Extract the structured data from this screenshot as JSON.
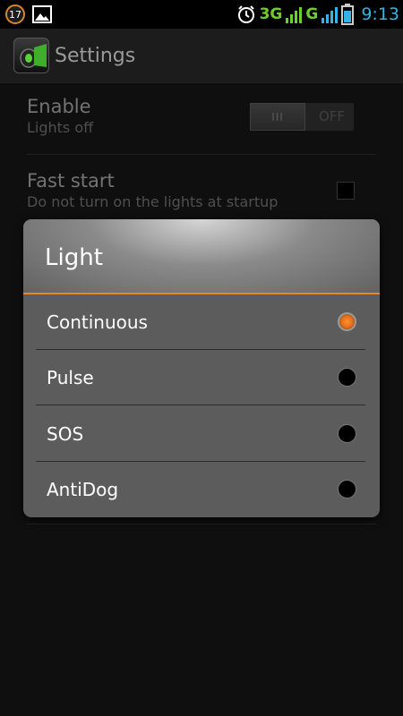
{
  "status_bar": {
    "notification_count": "17",
    "network_3g": "3G",
    "network_g": "G",
    "time": "9:13",
    "icons": [
      "gallery-icon",
      "alarm-icon",
      "signal-icon",
      "signal-icon",
      "battery-icon"
    ]
  },
  "action_bar": {
    "title": "Settings",
    "app_icon": "light-app-icon"
  },
  "prefs": {
    "enable": {
      "title": "Enable",
      "summary": "Lights off",
      "switch_label": "OFF",
      "switch_thumb": "III"
    },
    "fast_start": {
      "title": "Fast start",
      "summary": "Do not turn on the lights at startup",
      "checked": false
    }
  },
  "dialog": {
    "title": "Light",
    "options": [
      {
        "label": "Continuous",
        "selected": true
      },
      {
        "label": "Pulse",
        "selected": false
      },
      {
        "label": "SOS",
        "selected": false
      },
      {
        "label": "AntiDog",
        "selected": false
      }
    ]
  },
  "colors": {
    "accent": "#e08a2c",
    "time_blue": "#34b4e5",
    "signal_green": "#6ccf2a"
  }
}
